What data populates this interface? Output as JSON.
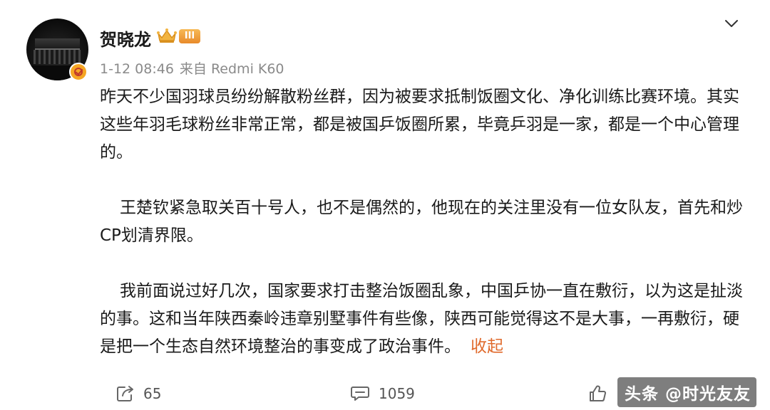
{
  "author": {
    "name": "贺晓龙",
    "level_label": "III"
  },
  "meta": {
    "timestamp": "1-12 08:46",
    "source": "来自 Redmi K60"
  },
  "post": {
    "paragraphs": [
      "昨天不少国羽球员纷纷解散粉丝群，因为被要求抵制饭圈文化、净化训练比赛环境。其实这些年羽毛球粉丝非常正常，都是被国乒饭圈所累，毕竟乒羽是一家，都是一个中心管理的。",
      "王楚钦紧急取关百十号人，也不是偶然的，他现在的关注里没有一位女队友，首先和炒CP划清界限。",
      "我前面说过好几次，国家要求打击整治饭圈乱象，中国乒协一直在敷衍，以为这是扯淡的事。这和当年陕西秦岭违章别墅事件有些像，陕西可能觉得这不是大事，一再敷衍，硬是把一个生态自然环境整治的事变成了政治事件。"
    ],
    "collapse_label": "收起"
  },
  "actions": {
    "repost_count": "65",
    "comment_count": "1059",
    "like_count": ""
  },
  "watermark": "头条 @时光友友",
  "icons": {
    "crown": "crown-icon",
    "verified": "verified-badge-icon",
    "more": "chevron-down-icon",
    "repost": "share-icon",
    "comment": "comment-icon",
    "like": "thumbs-up-icon"
  },
  "colors": {
    "accent": "#e06a2c",
    "badge": "#f5a623",
    "meta_text": "#8a8a8a"
  }
}
